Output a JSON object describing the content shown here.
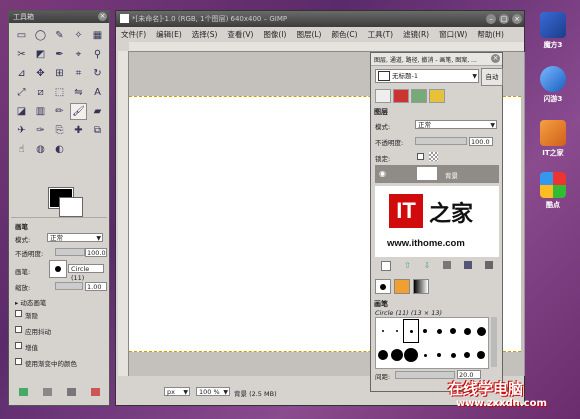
{
  "toolbox": {
    "title": "工具箱",
    "tools": [
      "rect-select-icon",
      "ellipse-select-icon",
      "free-select-icon",
      "fuzzy-select-icon",
      "color-select-icon",
      "scissors-icon",
      "foreground-select-icon",
      "paths-icon",
      "color-picker-icon",
      "zoom-icon",
      "measure-icon",
      "move-icon",
      "align-icon",
      "crop-icon",
      "rotate-icon",
      "scale-icon",
      "shear-icon",
      "perspective-icon",
      "flip-icon",
      "text-icon",
      "bucket-fill-icon",
      "blend-icon",
      "pencil-icon",
      "paintbrush-icon",
      "eraser-icon",
      "airbrush-icon",
      "ink-icon",
      "clone-icon",
      "heal-icon",
      "perspective-clone-icon",
      "smudge-icon",
      "blur-icon",
      "dodge-icon"
    ],
    "brush_options": {
      "header": "画笔",
      "mode_label": "模式:",
      "mode_value": "正常",
      "opacity_label": "不透明度:",
      "opacity_value": "100.0",
      "brush_label": "画笔:",
      "brush_value": "Circle (11)",
      "scale_label": "缩放:",
      "scale_value": "1.00",
      "dynamics_label": "动态画笔",
      "checkboxes": [
        "渐隐",
        "应用抖动",
        "增值",
        "使用渐变中的颜色"
      ]
    }
  },
  "image_window": {
    "title": "*[未命名]-1.0 (RGB, 1个图层) 640x400 – GIMP",
    "menu": [
      "文件(F)",
      "编辑(E)",
      "选择(S)",
      "查看(V)",
      "图像(I)",
      "图层(L)",
      "颜色(C)",
      "工具(T)",
      "滤镜(R)",
      "窗口(W)",
      "帮助(H)"
    ],
    "status": {
      "unit": "px",
      "zoom": "100 %",
      "info": "背景 (2.5 MB)"
    }
  },
  "dock": {
    "header": "图层, 通道, 路径, 撤消 - 画笔, 图案, ...",
    "image_select": "无标题-1",
    "auto_button": "自动",
    "layers": {
      "header": "图层",
      "mode_label": "模式:",
      "mode_value": "正常",
      "opacity_label": "不透明度:",
      "opacity_value": "100.0",
      "lock_label": "锁定:",
      "layer_name": "背景"
    },
    "brushes": {
      "header": "画笔",
      "current": "Circle (11) (13 × 13)",
      "spacing_label": "间距:",
      "spacing_value": "20.0"
    }
  },
  "logo": {
    "it": "IT",
    "home": "之家",
    "url": "www.ithome.com"
  },
  "desktop_icons": [
    "魔方3",
    "闪游3",
    "IT之家",
    "酷点"
  ],
  "watermark": {
    "text": "在线学电脑",
    "url": "www.zxxdn.com"
  }
}
